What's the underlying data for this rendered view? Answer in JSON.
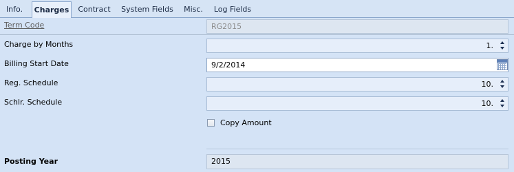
{
  "tabs": [
    {
      "label": "Info."
    },
    {
      "label": "Charges"
    },
    {
      "label": "Contract"
    },
    {
      "label": "System Fields"
    },
    {
      "label": "Misc."
    },
    {
      "label": "Log Fields"
    }
  ],
  "active_tab": "Charges",
  "form": {
    "term_code": {
      "label": "Term Code",
      "value": "RG2015"
    },
    "charge_by_months": {
      "label": "Charge by Months",
      "value": "1."
    },
    "billing_start_date": {
      "label": "Billing Start Date",
      "value": "9/2/2014"
    },
    "reg_schedule": {
      "label": "Reg. Schedule",
      "value": "10."
    },
    "schlr_schedule": {
      "label": "Schlr. Schedule",
      "value": "10."
    },
    "copy_amount": {
      "label": "Copy Amount",
      "checked": false
    },
    "posting_year": {
      "label": "Posting Year",
      "value": "2015"
    }
  },
  "icons": {
    "spin": "spinner-arrows-icon",
    "calendar": "calendar-icon"
  }
}
